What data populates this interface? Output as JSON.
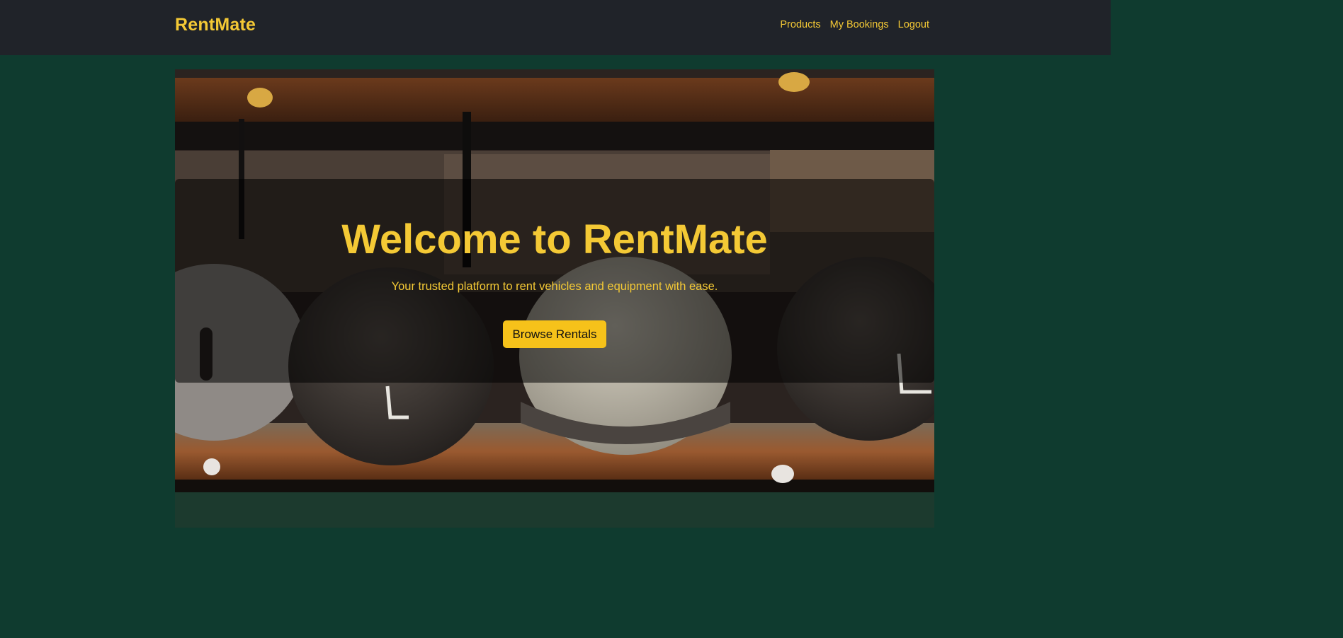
{
  "brand": "RentMate",
  "nav": {
    "products": "Products",
    "bookings": "My Bookings",
    "logout": "Logout"
  },
  "hero": {
    "title": "Welcome to RentMate",
    "subtitle": "Your trusted platform to rent vehicles and equipment with ease.",
    "cta": "Browse Rentals"
  },
  "colors": {
    "accent": "#f4c935",
    "navbar": "#202329",
    "page_bg": "#0f3b2f",
    "button": "#f6c21a"
  }
}
